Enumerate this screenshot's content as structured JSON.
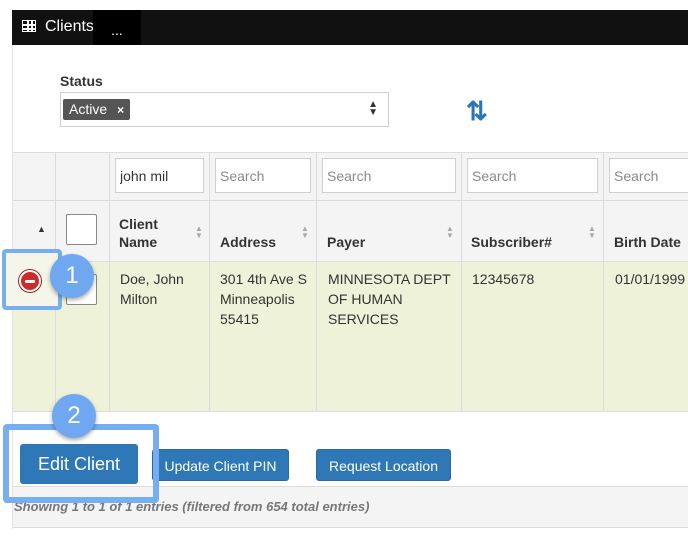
{
  "header": {
    "title": "Clients",
    "more": "..."
  },
  "filters": {
    "status_label": "Status",
    "status_tag": "Active",
    "status_tag_remove": "×"
  },
  "table": {
    "search": [
      {
        "value": "john mil",
        "placeholder": "Search"
      },
      {
        "value": "",
        "placeholder": "Search"
      },
      {
        "value": "",
        "placeholder": "Search"
      },
      {
        "value": "",
        "placeholder": "Search"
      },
      {
        "value": "",
        "placeholder": "Search"
      }
    ],
    "columns": [
      "Client Name",
      "Address",
      "Payer",
      "Subscriber#",
      "Birth Date"
    ],
    "rows": [
      {
        "client_name": "Doe, John Milton",
        "address": "301 4th Ave S Minneapolis 55415",
        "payer": "MINNESOTA DEPT OF HUMAN SERVICES",
        "subscriber": "12345678",
        "birth_date": "01/01/1999"
      }
    ]
  },
  "actions": {
    "edit_client": "Edit Client",
    "update_pin": "Update Client PIN",
    "request_location": "Request Location"
  },
  "info": "Showing 1 to 1 of 1 entries (filtered from 654 total entries)",
  "annotations": {
    "badge1": "1",
    "badge2": "2"
  },
  "colors": {
    "primary": "#2f78b7",
    "highlight": "#77aef2",
    "row_selected": "#eef2d8",
    "danger": "#cc2b2b"
  },
  "icons": {
    "title": "table-icon",
    "refresh": "refresh-icon",
    "collapse": "minus-circle-icon"
  }
}
